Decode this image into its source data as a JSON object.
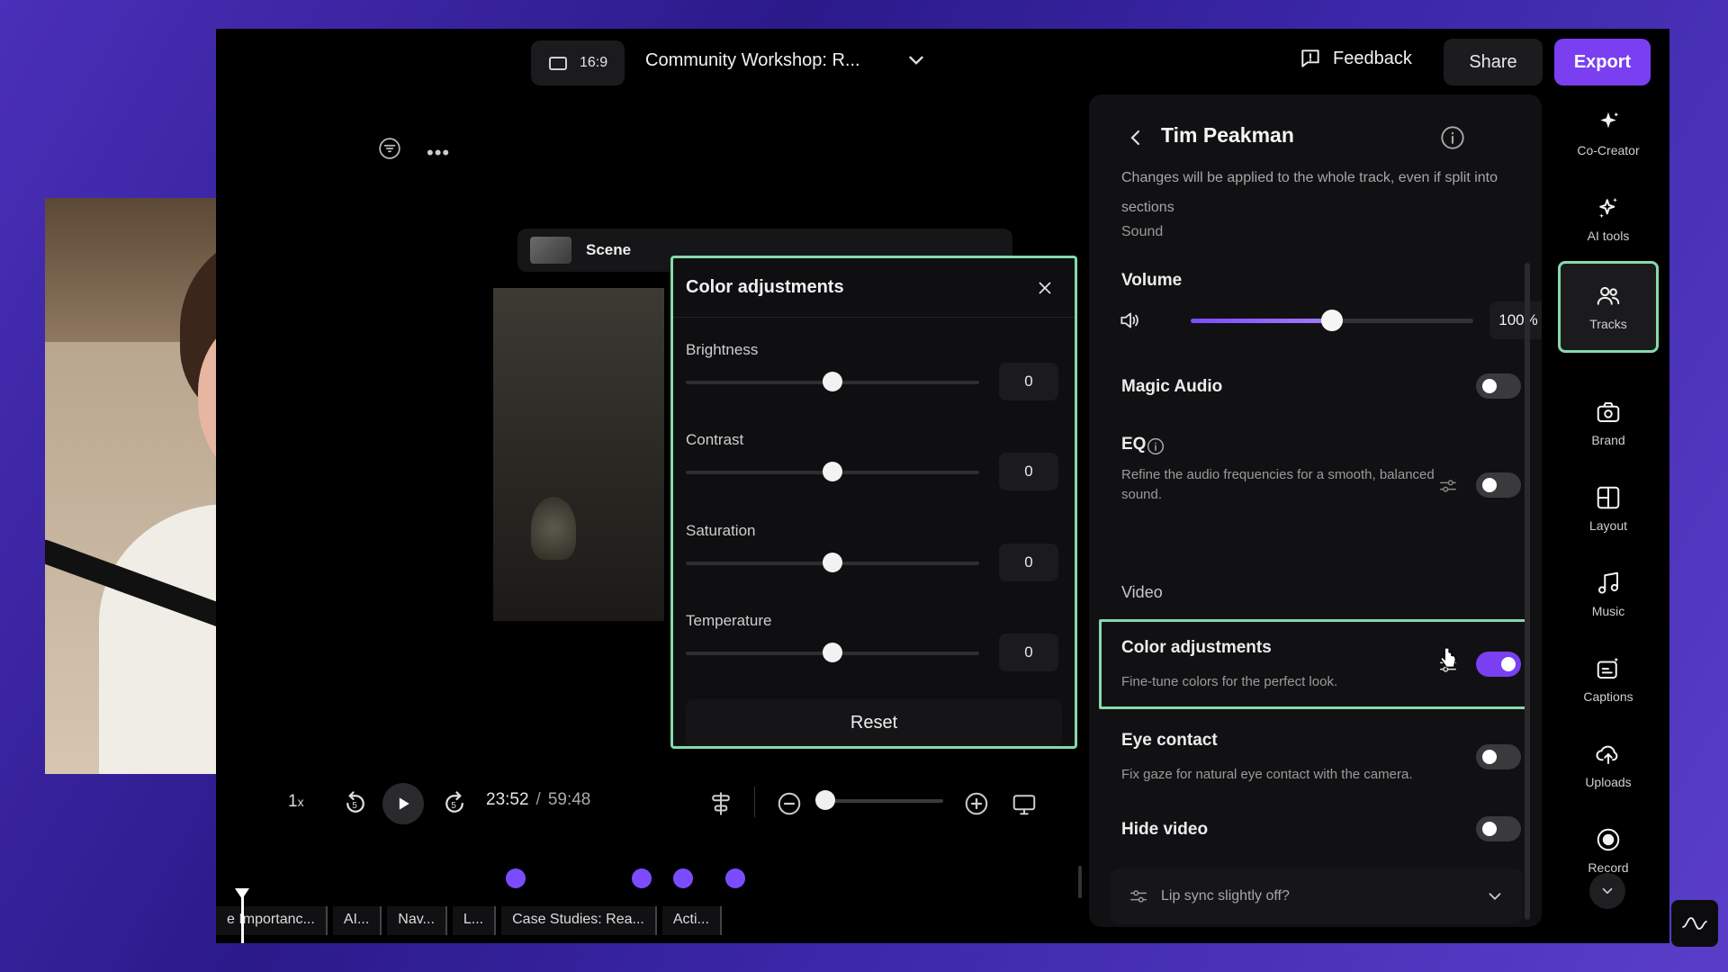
{
  "topbar": {
    "aspect_ratio": "16:9",
    "project_title": "Community Workshop: R...",
    "feedback_label": "Feedback",
    "share_label": "Share",
    "export_label": "Export"
  },
  "scene": {
    "tab_label": "Scene"
  },
  "color_adjustments_popup": {
    "title": "Color adjustments",
    "sliders": [
      {
        "label": "Brightness",
        "value": "0"
      },
      {
        "label": "Contrast",
        "value": "0"
      },
      {
        "label": "Saturation",
        "value": "0"
      },
      {
        "label": "Temperature",
        "value": "0"
      }
    ],
    "reset_label": "Reset"
  },
  "track_panel": {
    "title": "Tim Peakman",
    "note": "Changes will be applied to the whole track, even if split into sections",
    "section_sound": "Sound",
    "volume_label": "Volume",
    "volume_value": "100%",
    "volume_fraction": 0.5,
    "magic_audio_label": "Magic Audio",
    "magic_audio_on": false,
    "eq_label": "EQ",
    "eq_desc": "Refine the audio frequencies for a smooth, balanced sound.",
    "eq_on": false,
    "section_video": "Video",
    "color_adj_label": "Color adjustments",
    "color_adj_desc": "Fine-tune colors for the perfect look.",
    "color_adj_on": true,
    "eye_contact_label": "Eye contact",
    "eye_contact_desc": "Fix gaze for natural eye contact with the camera.",
    "eye_contact_on": false,
    "hide_video_label": "Hide video",
    "hide_video_on": false,
    "lipsync_label": "Lip sync slightly off?"
  },
  "rail": {
    "items": [
      {
        "label": "Co-Creator",
        "icon": "sparkle-icon"
      },
      {
        "label": "AI tools",
        "icon": "ai-sparkles-icon"
      },
      {
        "label": "Tracks",
        "icon": "people-icon",
        "active": true
      },
      {
        "label": "Brand",
        "icon": "camera-badge-icon"
      },
      {
        "label": "Layout",
        "icon": "layout-icon"
      },
      {
        "label": "Music",
        "icon": "music-note-icon"
      },
      {
        "label": "Captions",
        "icon": "captions-icon"
      },
      {
        "label": "Uploads",
        "icon": "upload-cloud-icon"
      },
      {
        "label": "Record",
        "icon": "record-icon"
      }
    ]
  },
  "playback": {
    "speed": "1",
    "speed_suffix": "x",
    "current_time": "23:52",
    "separator": "/",
    "total_time": "59:48"
  },
  "timeline": {
    "chapters": [
      "e Importanc...",
      "AI...",
      "Nav...",
      "L...",
      "Case Studies: Rea...",
      "Acti..."
    ]
  },
  "colors": {
    "accent": "#7b3ff2",
    "highlight": "#86d9ab",
    "panel": "#111113",
    "marker": "#7b4cff"
  }
}
